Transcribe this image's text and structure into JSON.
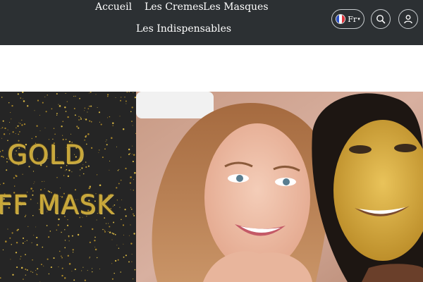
{
  "nav": {
    "links": [
      "Accueil",
      "Les Cremes",
      "Les Masques",
      "Les Indispensables"
    ],
    "language": "Fr",
    "colors": {
      "bar": "#2c3033",
      "text": "#ffffff"
    },
    "icons": [
      "flag-france-icon",
      "search-icon",
      "account-icon"
    ]
  },
  "hero": {
    "banner_text_line1": "GOLD",
    "banner_text_line2": "FF MASK",
    "gold_color": "#c9a83a"
  }
}
